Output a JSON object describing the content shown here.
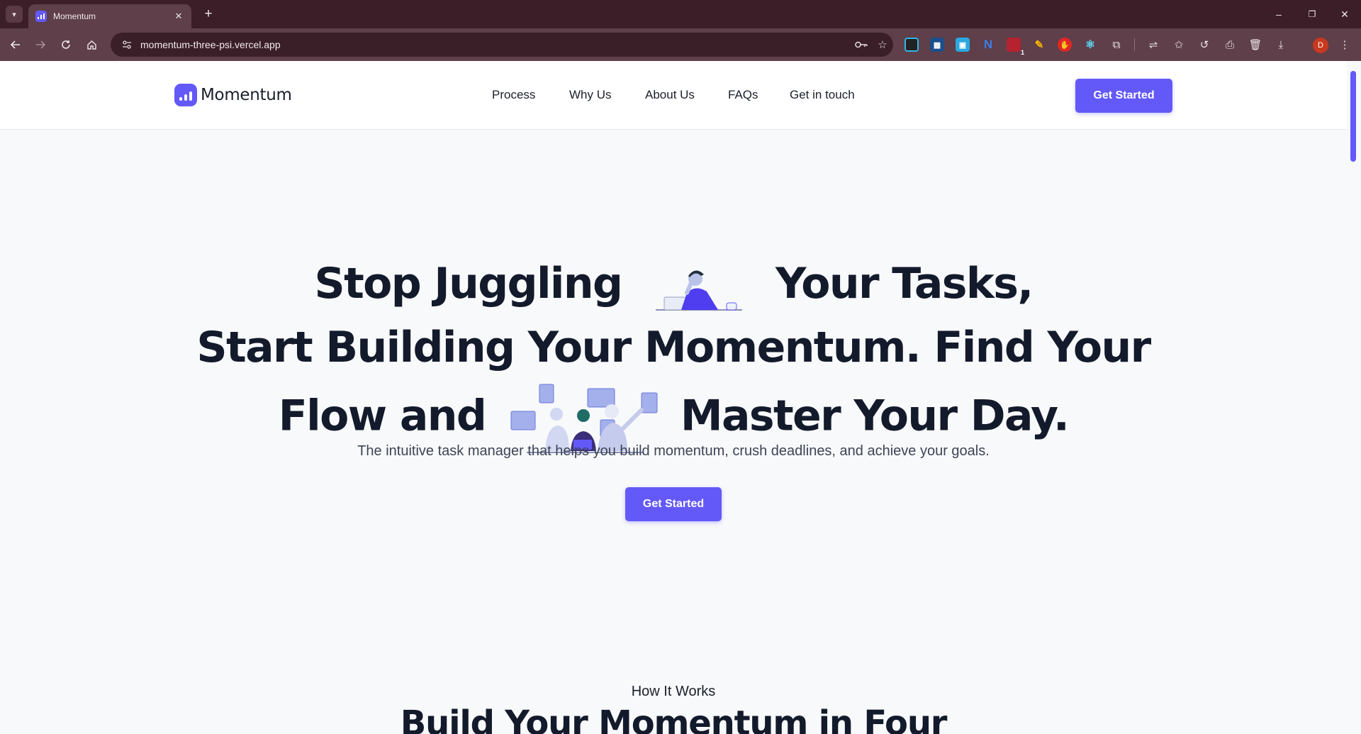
{
  "browser": {
    "tab_title": "Momentum",
    "tab_close": "✕",
    "new_tab": "+",
    "url": "momentum-three-psi.vercel.app",
    "profile_initial": "D",
    "ext_badge": "1",
    "window_controls": [
      "–",
      "❐",
      "✕"
    ],
    "icons": [
      "back-icon",
      "forward-icon",
      "reload-icon",
      "home-icon",
      "site-info-icon",
      "password-key-icon",
      "bookmark-star-icon",
      "extensions-icon",
      "history-icon",
      "print-icon",
      "trash-icon",
      "download-icon",
      "menu-icon"
    ]
  },
  "site": {
    "brand": "Momentum",
    "nav": [
      "Process",
      "Why Us",
      "About Us",
      "FAQs",
      "Get in touch"
    ],
    "header_cta": "Get Started",
    "accent": "#6359f8"
  },
  "hero": {
    "line1_a": "Stop Juggling",
    "line1_b": "Your Tasks,",
    "line2": "Start Building Your Momentum. Find Your",
    "line3_a": "Flow and",
    "line3_b": "Master Your Day.",
    "subtitle": "The intuitive task manager that helps you build momentum, crush deadlines, and achieve your goals.",
    "cta": "Get Started"
  },
  "how_it_works": {
    "eyebrow": "How It Works",
    "title": "Build Your Momentum in Four"
  }
}
